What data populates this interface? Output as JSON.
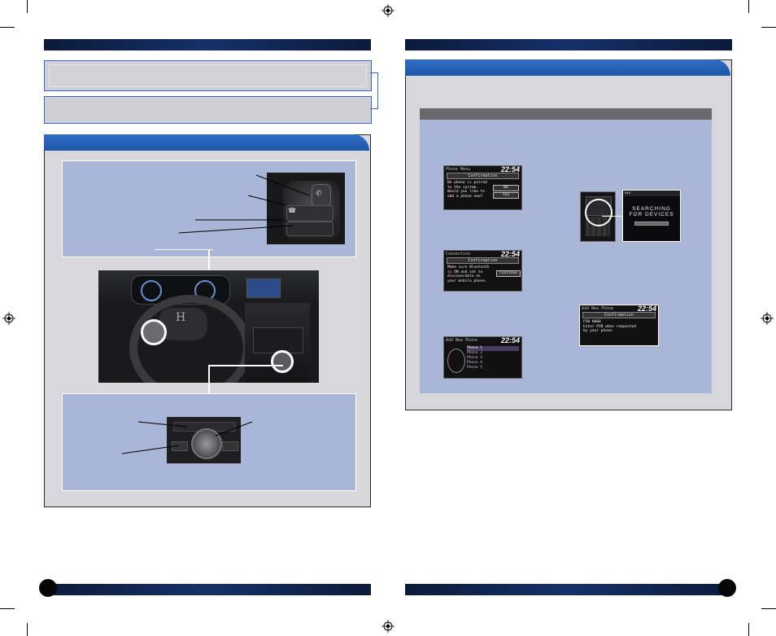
{
  "left_page": {
    "section_header": "",
    "callout_top": "",
    "callout_bottom": "",
    "panel_title": ""
  },
  "right_page": {
    "section_header": "",
    "panel_title": "",
    "subheader": ""
  },
  "screens": {
    "phone_menu": {
      "title": "Phone Menu",
      "time": "22:54",
      "heading": "Confirmation",
      "body": "No phone is paired\nto the system.\nWould you like to\nadd a phone now?",
      "no_label": "NO",
      "yes_label": "YES"
    },
    "connection": {
      "title": "Connection",
      "time": "22:54",
      "heading": "Confirmation",
      "body": "Make sure Bluetooth\nis ON and set to\ndiscoverable on\nyour mobile phone.",
      "continue_label": "Continue"
    },
    "add_new_phone_list": {
      "title": "Add New Phone",
      "time": "22:54",
      "items": [
        "Phone 1",
        "Phone 2",
        "Phone 3",
        "Phone 4",
        "Phone 5"
      ]
    },
    "searching": {
      "text_line1": "SEARCHING",
      "text_line2": "FOR DEVICES"
    },
    "add_new_phone_pin": {
      "title": "Add New Phone",
      "time": "22:54",
      "heading": "Confirmation",
      "body": "PIN 0000\nEnter PIN when requested\nby your phone."
    }
  },
  "colors": {
    "header_bar": "#15306a",
    "blue_tab": "#2f6fc7",
    "panel_blue": "#a9b6d7",
    "panel_grey": "#d8d8dc"
  }
}
